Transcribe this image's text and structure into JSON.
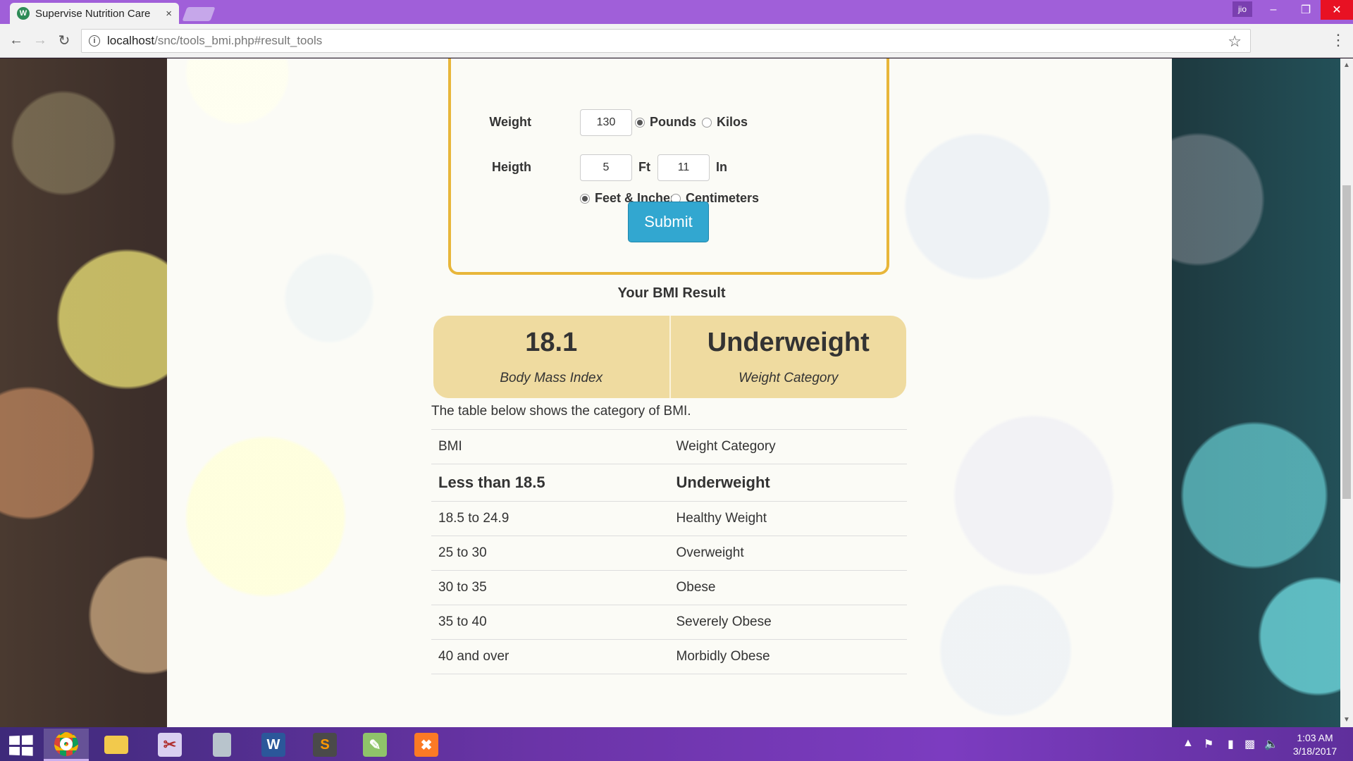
{
  "browser": {
    "tab_title": "Supervise Nutrition Care",
    "tab_close": "×",
    "profile_label": "jio",
    "url_host": "localhost",
    "url_path": "/snc/tools_bmi.php#result_tools"
  },
  "form": {
    "weight_label": "Weight",
    "weight_value": "130",
    "pounds_label": "Pounds",
    "kilos_label": "Kilos",
    "weight_unit_selected": "Pounds",
    "height_label": "Heigth",
    "feet_value": "5",
    "ft_unit": "Ft",
    "inches_value": "11",
    "in_unit": "In",
    "feet_inches_label": "Feet & Inches",
    "centimeters_label": "Centimeters",
    "height_unit_selected": "Feet & Inches",
    "submit_label": "Submit"
  },
  "result": {
    "title": "Your BMI Result",
    "bmi_value": "18.1",
    "bmi_caption": "Body Mass Index",
    "category_value": "Underweight",
    "category_caption": "Weight Category"
  },
  "table": {
    "note": "The table below shows the category of BMI.",
    "header": [
      "BMI",
      "Weight Category"
    ],
    "rows": [
      [
        "Less than 18.5",
        "Underweight"
      ],
      [
        "18.5 to 24.9",
        "Healthy Weight"
      ],
      [
        "25 to 30",
        "Overweight"
      ],
      [
        "30 to 35",
        "Obese"
      ],
      [
        "35 to 40",
        "Severely Obese"
      ],
      [
        "40 and over",
        "Morbidly Obese"
      ]
    ],
    "highlighted_row": 0
  },
  "taskbar": {
    "apps": [
      "chrome-icon",
      "file-explorer-icon",
      "snipping-tool-icon",
      "calculator-icon",
      "word-icon",
      "sublime-text-icon",
      "notepad-icon",
      "xampp-icon"
    ],
    "clock_time": "1:03 AM",
    "clock_date": "3/18/2017"
  },
  "colors": {
    "accent_border": "#e8b63a",
    "submit_button": "#32a7d0",
    "result_panel": "#efdba0",
    "titlebar": "#a05fd9"
  }
}
